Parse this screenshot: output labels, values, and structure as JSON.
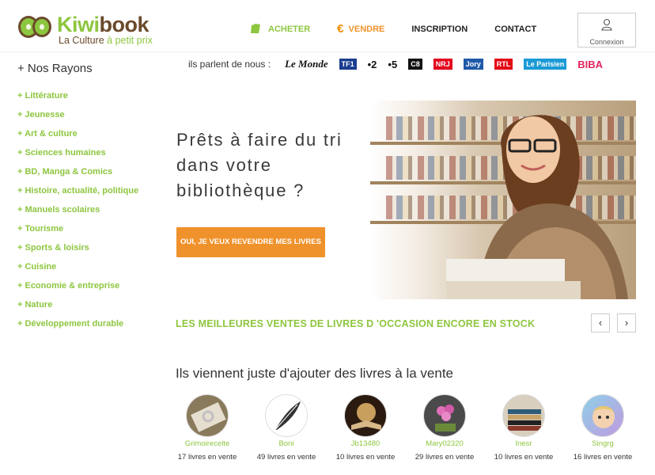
{
  "brand": {
    "name_part1": "Kiwi",
    "name_part2": "book",
    "tagline_part1": "La Culture ",
    "tagline_part2": "à petit prix",
    "accent_green": "#8dc63f",
    "accent_orange": "#f0922b"
  },
  "nav": {
    "buy": "ACHETER",
    "sell": "VENDRE",
    "signup": "INSCRIPTION",
    "contact": "CONTACT",
    "login": "Connexion"
  },
  "sidebar": {
    "title": "+ Nos Rayons",
    "items": [
      "+ Littérature",
      "+ Jeunesse",
      "+ Art & culture",
      "+ Sciences humaines",
      "+ BD, Manga & Comics",
      "+ Histoire, actualité, politique",
      "+ Manuels scolaires",
      "+ Tourisme",
      "+ Sports & loisirs",
      "+ Cuisine",
      "+ Economie & entreprise",
      "+ Nature",
      "+ Développement durable"
    ]
  },
  "press": {
    "label": "ils parlent de nous :",
    "logos": [
      "Le Monde",
      "TF1",
      "2",
      "5",
      "C8",
      "NRJ",
      "Jory",
      "RTL",
      "Le Parisien",
      "BIBA"
    ]
  },
  "hero": {
    "title": "Prêts à faire du tri dans votre bibliothèque ?",
    "button": "OUI, JE VEUX REVENDRE MES LIVRES"
  },
  "best_sellers": {
    "title": "LES MEILLEURES VENTES DE LIVRES D 'OCCASION ENCORE EN STOCK",
    "prev": "‹",
    "next": "›"
  },
  "sellers": {
    "title": "Ils viennent juste d'ajouter des livres à la vente",
    "items": [
      {
        "name": "Grimoirecelte",
        "count": "17 livres en vente"
      },
      {
        "name": "Boni",
        "count": "49 livres en vente"
      },
      {
        "name": "Jb13480",
        "count": "10 livres en vente"
      },
      {
        "name": "Mary02320",
        "count": "29 livres en vente"
      },
      {
        "name": "Inesr",
        "count": "10 livres en vente"
      },
      {
        "name": "Singrg",
        "count": "16 livres en vente"
      }
    ]
  }
}
